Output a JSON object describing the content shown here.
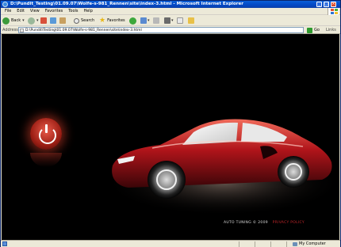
{
  "window": {
    "title": "D:\\Pundit_Testing\\01.09.07\\Wolfe-s-981_Rennen\\site\\index-3.html - Microsoft Internet Explorer"
  },
  "menu": {
    "items": [
      "File",
      "Edit",
      "View",
      "Favorites",
      "Tools",
      "Help"
    ]
  },
  "toolbar": {
    "back_label": "Back",
    "search_label": "Search",
    "favorites_label": "Favorites"
  },
  "address": {
    "label": "Address",
    "value": "D:\\Pundit\\Testing\\01.09.07\\Wolfe-s-981_Rennen\\site\\index-3.html",
    "go_label": "Go",
    "links_label": "Links"
  },
  "page": {
    "brand_text": "AUTO TUNING © 2009",
    "brand_link": "PRIVACY POLICY",
    "accent_color": "#c0252a"
  },
  "status": {
    "zone": "My Computer"
  },
  "icons": [
    "ie-logo-icon",
    "back-icon",
    "forward-icon",
    "stop-icon",
    "refresh-icon",
    "home-icon",
    "search-icon",
    "favorites-icon",
    "media-icon",
    "mail-icon",
    "print-icon",
    "edit-icon",
    "discuss-icon",
    "folder-icon",
    "go-icon",
    "power-icon",
    "computer-icon"
  ]
}
